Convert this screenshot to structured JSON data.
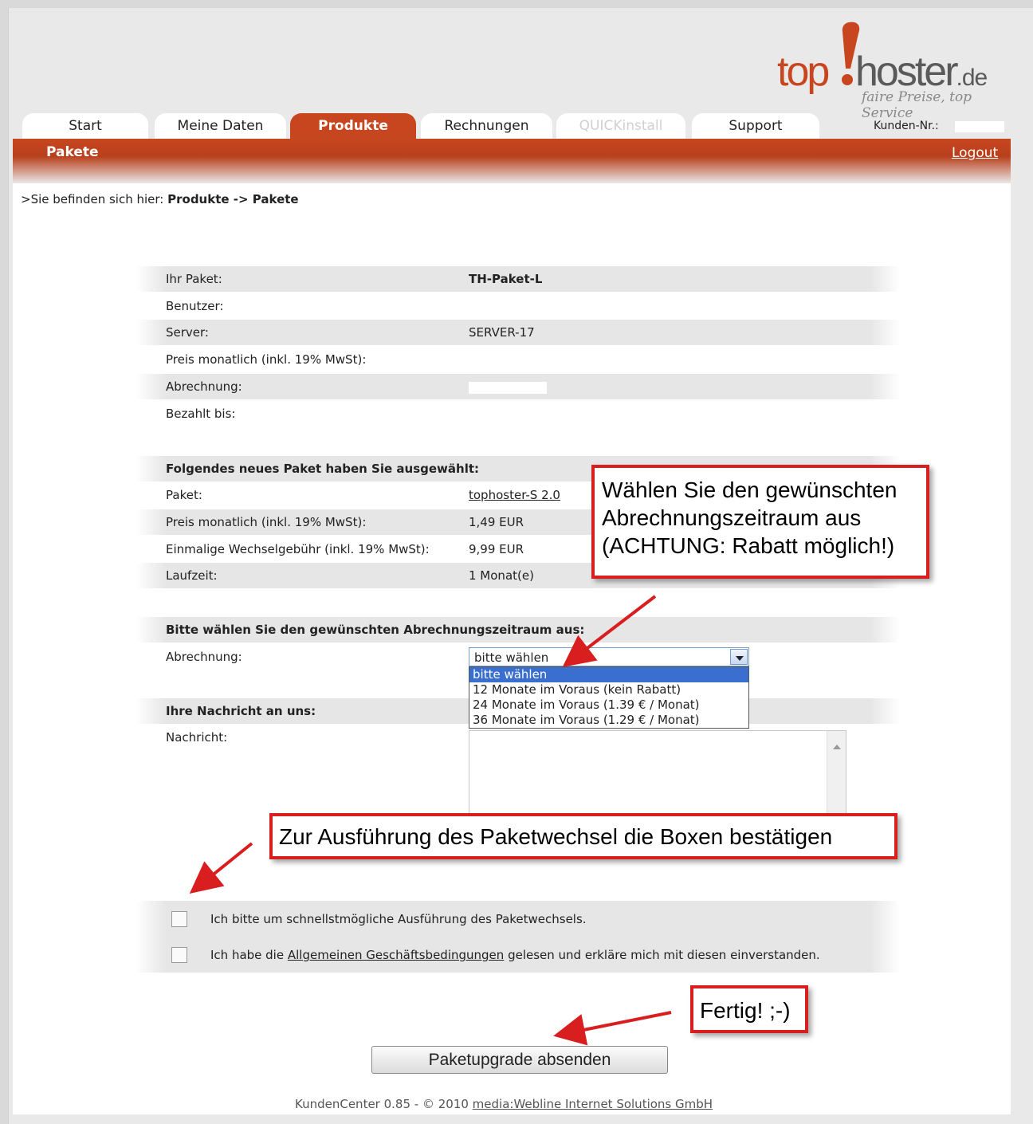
{
  "header": {
    "logo_top": "top",
    "logo_host": "hoster",
    "logo_tld": ".de",
    "tagline": "faire Preise, top Service",
    "customer_no_label": "Kunden-Nr.:"
  },
  "tabs": [
    {
      "label": "Start"
    },
    {
      "label": "Meine Daten"
    },
    {
      "label": "Produkte"
    },
    {
      "label": "Rechnungen"
    },
    {
      "label": "QUICKinstall"
    },
    {
      "label": "Support"
    }
  ],
  "subnav": {
    "title": "Pakete",
    "logout": "Logout"
  },
  "breadcrumb": {
    "prefix": ">Sie befinden sich hier: ",
    "path": "Produkte -> Pakete"
  },
  "current_package": {
    "rows": [
      {
        "label": "Ihr Paket:",
        "value": "TH-Paket-L"
      },
      {
        "label": "Benutzer:",
        "value": ""
      },
      {
        "label": "Server:",
        "value": "SERVER-17"
      },
      {
        "label": "Preis monatlich (inkl. 19% MwSt):",
        "value": ""
      },
      {
        "label": "Abrechnung:",
        "value": ""
      },
      {
        "label": "Bezahlt bis:",
        "value": ""
      }
    ]
  },
  "new_package": {
    "heading": "Folgendes neues Paket haben Sie ausgewählt:",
    "rows": [
      {
        "label": "Paket:",
        "value": "tophoster-S 2.0"
      },
      {
        "label": "Preis monatlich (inkl. 19% MwSt):",
        "value": "1,49 EUR"
      },
      {
        "label": "Einmalige Wechselgebühr (inkl. 19% MwSt):",
        "value": "9,99 EUR"
      },
      {
        "label": "Laufzeit:",
        "value": "1 Monat(e)"
      }
    ]
  },
  "billing": {
    "heading": "Bitte wählen Sie den gewünschten Abrechnungszeitraum aus:",
    "label": "Abrechnung:",
    "selected": "bitte wählen",
    "options": [
      "bitte wählen",
      "12 Monate im Voraus (kein Rabatt)",
      "24 Monate im Voraus (1.39 € / Monat)",
      "36 Monate im Voraus (1.29 € / Monat)"
    ]
  },
  "message": {
    "heading": "Ihre Nachricht an uns:",
    "label": "Nachricht:"
  },
  "checkboxes": {
    "first": "Ich bitte um schnellstmögliche Ausführung des Paketwechsels.",
    "second_prefix": "Ich habe die ",
    "second_link": "Allgemeinen Geschäftsbedingungen",
    "second_suffix": " gelesen und erkläre mich mit diesen einverstanden."
  },
  "submit_label": "Paketupgrade absenden",
  "footer": {
    "text": "KundenCenter 0.85 - © 2010 ",
    "link": "media:Webline Internet Solutions GmbH"
  },
  "callouts": {
    "billing": [
      "Wählen Sie den gewünschten",
      "Abrechnungszeitraum aus",
      "(ACHTUNG: Rabatt möglich!)"
    ],
    "confirm": "Zur Ausführung des Paketwechsel die Boxen bestätigen",
    "done": "Fertig! ;-)"
  },
  "colors": {
    "brand": "#c7461f",
    "callout_border": "#d81e1e",
    "selection": "#3a6fd0"
  }
}
